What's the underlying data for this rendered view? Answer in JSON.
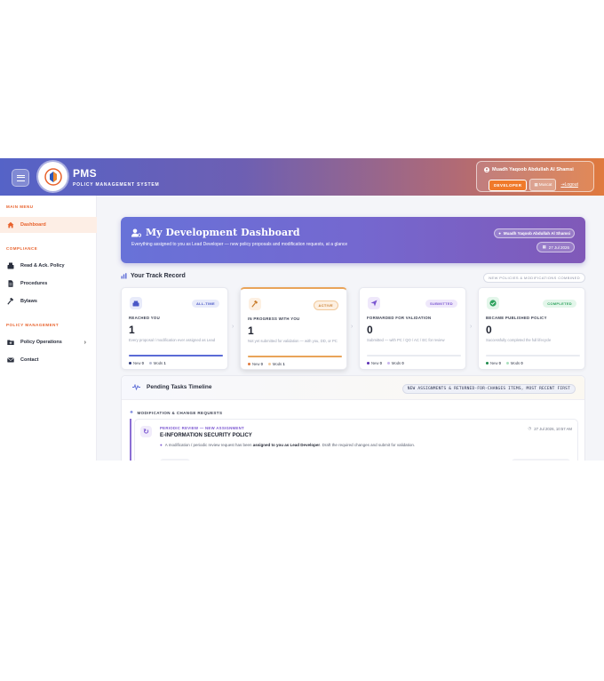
{
  "header": {
    "brand_title": "PMS",
    "brand_subtitle": "POLICY MANAGEMENT SYSTEM",
    "user_name": "Muadh Yaqoob Abdullah Al Shamsi",
    "role": "DEVELOPER",
    "location": "Muscat",
    "logout": "Logout",
    "colors": {
      "accent": "#e8622c",
      "gradient_start": "#5563c7",
      "gradient_end": "#e07a3e"
    }
  },
  "sidebar": {
    "sections": [
      {
        "label": "MAIN MENU"
      },
      {
        "label": "COMPLIANCE"
      },
      {
        "label": "POLICY MANAGEMENT"
      }
    ],
    "items": [
      {
        "label": "Dashboard",
        "icon": "home-icon"
      },
      {
        "label": "Read & Ack. Policy",
        "icon": "inbox-icon"
      },
      {
        "label": "Procedures",
        "icon": "document-icon"
      },
      {
        "label": "Bylaws",
        "icon": "gavel-icon"
      },
      {
        "label": "Policy Operations",
        "icon": "folder-plus-icon"
      },
      {
        "label": "Contact",
        "icon": "envelope-icon"
      }
    ]
  },
  "hero": {
    "title": "My Development Dashboard",
    "subtitle": "Everything assigned to you as Lead Developer — new policy proposals and modification requests, at a glance",
    "user": "Muadh Yaqoob Abdullah Al Shamsi",
    "date": "27 Jul 2026"
  },
  "track": {
    "title": "Your Track Record",
    "pill": "NEW POLICIES & MODIFICATIONS COMBINED",
    "cards": [
      {
        "badge": "ALL-TIME",
        "label": "REACHED YOU",
        "value": "1",
        "desc": "Every proposal / modification ever assigned as Lead",
        "new_label": "New",
        "new_value": "0",
        "mods_label": "Mods",
        "mods_value": "1",
        "progress": 1.0,
        "color": "#5b6bd6",
        "icon": "inbox-icon"
      },
      {
        "badge": "ACTIVE",
        "label": "IN PROGRESS WITH YOU",
        "value": "1",
        "desc": "Not yet submitted for validation — with you, DD, or PC",
        "new_label": "New",
        "new_value": "0",
        "mods_label": "Mods",
        "mods_value": "1",
        "progress": 1.0,
        "color": "#e9a45a",
        "icon": "hammer-icon"
      },
      {
        "badge": "SUBMITTED",
        "label": "FORWARDED FOR VALIDATION",
        "value": "0",
        "desc": "Submitted — with PC / QO / AC / EC for review",
        "new_label": "New",
        "new_value": "0",
        "mods_label": "Mods",
        "mods_value": "0",
        "progress": 0.0,
        "color": "#8a5cd6",
        "icon": "send-icon"
      },
      {
        "badge": "COMPLETED",
        "label": "BECAME PUBLISHED POLICY",
        "value": "0",
        "desc": "Successfully completed the full lifecycle",
        "new_label": "New",
        "new_value": "0",
        "mods_label": "Mods",
        "mods_value": "0",
        "progress": 0.0,
        "color": "#35b56a",
        "icon": "check-circle-icon"
      }
    ]
  },
  "timeline": {
    "title": "Pending Tasks Timeline",
    "pill": "NEW ASSIGNMENTS & RETURNED-FOR-CHANGES ITEMS, MOST RECENT FIRST",
    "section": "MODIFICATION & CHANGE REQUESTS",
    "task": {
      "kicker": "PERIODIC REVIEW — NEW ASSIGNMENT",
      "title": "E-INFORMATION SECURITY POLICY",
      "desc_before": "A modification / periodic review request has been",
      "desc_bold": "assigned to you as Lead Developer",
      "desc_after": ". Draft the required changes and submit for validation.",
      "time": "27 Jul 2026, 10:57 AM"
    }
  }
}
